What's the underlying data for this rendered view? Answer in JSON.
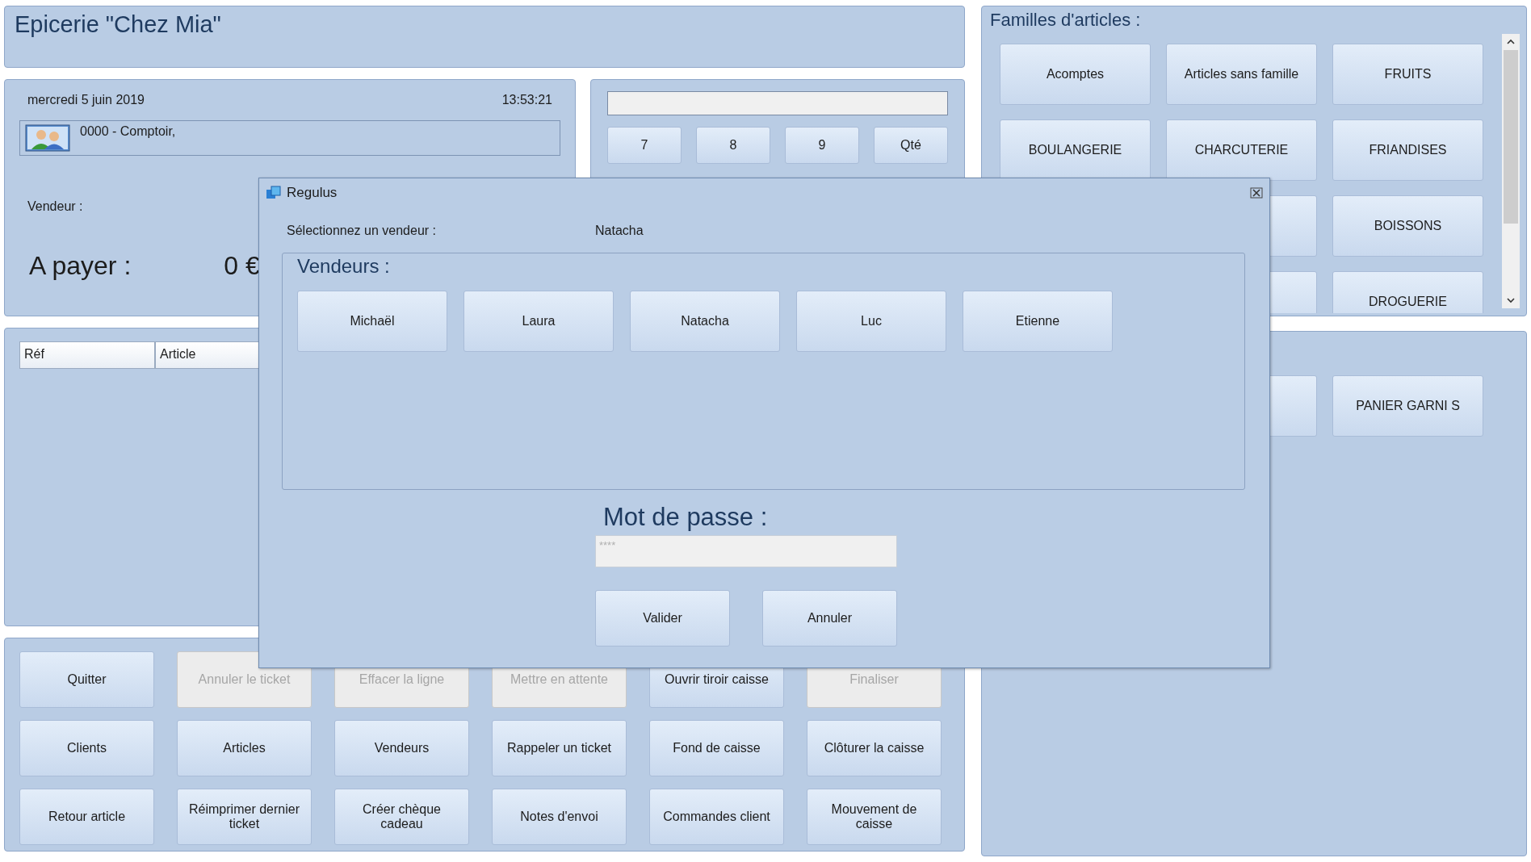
{
  "header": {
    "title": "Epicerie \"Chez Mia\""
  },
  "info": {
    "date": "mercredi 5 juin 2019",
    "time": "13:53:21",
    "customer": "0000 - Comptoir,",
    "vendor_label": "Vendeur :",
    "pay_label": "A payer :",
    "pay_amount": "0 €"
  },
  "keypad": {
    "keys": [
      "7",
      "8",
      "9",
      "Qté"
    ]
  },
  "table": {
    "columns": [
      "Réf",
      "Article"
    ]
  },
  "actions": [
    {
      "label": "Quitter",
      "disabled": false
    },
    {
      "label": "Annuler le ticket",
      "disabled": true
    },
    {
      "label": "Effacer la ligne",
      "disabled": true
    },
    {
      "label": "Mettre en attente",
      "disabled": true
    },
    {
      "label": "Ouvrir tiroir caisse",
      "disabled": false
    },
    {
      "label": "Finaliser",
      "disabled": true
    },
    {
      "label": "Clients",
      "disabled": false
    },
    {
      "label": "Articles",
      "disabled": false
    },
    {
      "label": "Vendeurs",
      "disabled": false
    },
    {
      "label": "Rappeler un ticket",
      "disabled": false
    },
    {
      "label": "Fond de caisse",
      "disabled": false
    },
    {
      "label": "Clôturer la caisse",
      "disabled": false
    },
    {
      "label": "Retour article",
      "disabled": false
    },
    {
      "label": "Réimprimer dernier ticket",
      "disabled": false
    },
    {
      "label": "Créer chèque cadeau",
      "disabled": false
    },
    {
      "label": "Notes d'envoi",
      "disabled": false
    },
    {
      "label": "Commandes client",
      "disabled": false
    },
    {
      "label": "Mouvement de caisse",
      "disabled": false
    }
  ],
  "families": {
    "title": "Familles d'articles :",
    "rows": [
      [
        "Acomptes",
        "Articles sans famille",
        "FRUITS"
      ],
      [
        "BOULANGERIE",
        "CHARCUTERIE",
        "FRIANDISES"
      ],
      [
        "BOISSONS"
      ],
      [
        "DROGUERIE"
      ]
    ]
  },
  "products": {
    "rows": [
      [
        "PANIER GARNI S"
      ]
    ]
  },
  "dialog": {
    "title": "Regulus",
    "prompt": "Sélectionnez un vendeur :",
    "selected_name": "Natacha",
    "group_title": "Vendeurs :",
    "vendors": [
      {
        "name": "Michaël"
      },
      {
        "name": "Laura"
      },
      {
        "name": "Natacha"
      },
      {
        "name": "Luc"
      },
      {
        "name": "Etienne"
      }
    ],
    "password_label": "Mot de passe :",
    "password_placeholder": "****",
    "buttons": [
      "Valider",
      "Annuler"
    ]
  }
}
